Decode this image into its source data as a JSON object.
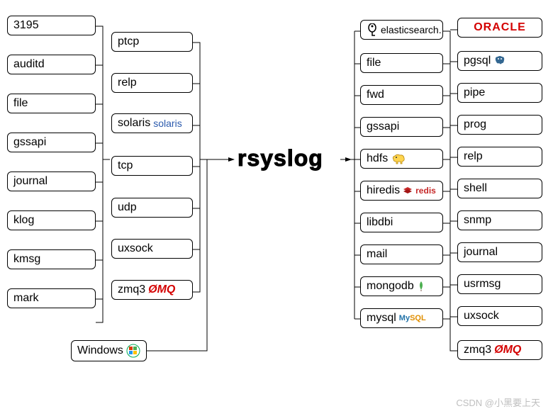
{
  "center": "rsyslog",
  "watermark": "CSDN @小黑要上天",
  "inputs": {
    "left": [
      "3195",
      "auditd",
      "file",
      "gssapi",
      "journal",
      "klog",
      "kmsg",
      "mark"
    ],
    "right": [
      "ptcp",
      "relp",
      "solaris",
      "tcp",
      "udp",
      "uxsock",
      "zmq3"
    ],
    "bottom": "Windows"
  },
  "outputs": {
    "left": [
      "elasticsearch.",
      "file",
      "fwd",
      "gssapi",
      "hdfs",
      "hiredis",
      "libdbi",
      "mail",
      "mongodb",
      "mysql"
    ],
    "right_top": "ORACLE",
    "right": [
      "pgsql",
      "pipe",
      "prog",
      "relp",
      "shell",
      "snmp",
      "journal",
      "usrmsg",
      "uxsock",
      "zmq3"
    ]
  },
  "logos": {
    "solaris": "solaris",
    "zmq_in": "ØMQ",
    "zmq_out": "ØMQ",
    "redis": "redis",
    "mysql": "MySQL"
  }
}
